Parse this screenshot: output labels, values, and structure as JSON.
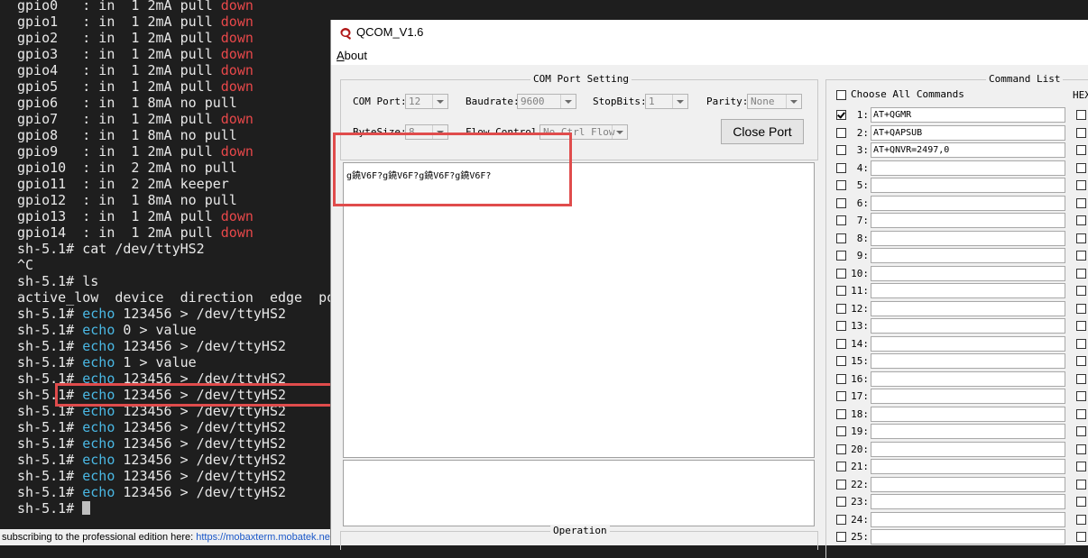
{
  "terminal": {
    "lines": [
      [
        {
          "t": "gpio0   : in  1 2mA pull "
        },
        {
          "t": "down",
          "c": "red"
        }
      ],
      [
        {
          "t": "gpio1   : in  1 2mA pull "
        },
        {
          "t": "down",
          "c": "red"
        }
      ],
      [
        {
          "t": "gpio2   : in  1 2mA pull "
        },
        {
          "t": "down",
          "c": "red"
        }
      ],
      [
        {
          "t": "gpio3   : in  1 2mA pull "
        },
        {
          "t": "down",
          "c": "red"
        }
      ],
      [
        {
          "t": "gpio4   : in  1 2mA pull "
        },
        {
          "t": "down",
          "c": "red"
        }
      ],
      [
        {
          "t": "gpio5   : in  1 2mA pull "
        },
        {
          "t": "down",
          "c": "red"
        }
      ],
      [
        {
          "t": "gpio6   : in  1 8mA no pull"
        }
      ],
      [
        {
          "t": "gpio7   : in  1 2mA pull "
        },
        {
          "t": "down",
          "c": "red"
        }
      ],
      [
        {
          "t": "gpio8   : in  1 8mA no pull"
        }
      ],
      [
        {
          "t": "gpio9   : in  1 2mA pull "
        },
        {
          "t": "down",
          "c": "red"
        }
      ],
      [
        {
          "t": "gpio10  : in  2 2mA no pull"
        }
      ],
      [
        {
          "t": "gpio11  : in  2 2mA keeper"
        }
      ],
      [
        {
          "t": "gpio12  : in  1 8mA no pull"
        }
      ],
      [
        {
          "t": "gpio13  : in  1 2mA pull "
        },
        {
          "t": "down",
          "c": "red"
        }
      ],
      [
        {
          "t": "gpio14  : in  1 2mA pull "
        },
        {
          "t": "down",
          "c": "red"
        }
      ],
      [
        {
          "t": "sh-5.1# cat /dev/ttyHS2"
        }
      ],
      [
        {
          "t": "^C"
        }
      ],
      [
        {
          "t": "sh-5.1# ls"
        }
      ],
      [
        {
          "t": "active_low  device  direction  edge  po"
        }
      ],
      [
        {
          "t": "sh-5.1# "
        },
        {
          "t": "echo",
          "c": "cyan"
        },
        {
          "t": " 123456 > /dev/ttyHS2"
        }
      ],
      [
        {
          "t": "sh-5.1# "
        },
        {
          "t": "echo",
          "c": "cyan"
        },
        {
          "t": " 0 > value"
        }
      ],
      [
        {
          "t": "sh-5.1# "
        },
        {
          "t": "echo",
          "c": "cyan"
        },
        {
          "t": " 123456 > /dev/ttyHS2"
        }
      ],
      [
        {
          "t": "sh-5.1# "
        },
        {
          "t": "echo",
          "c": "cyan"
        },
        {
          "t": " 1 > value"
        }
      ],
      [
        {
          "t": "sh-5.1# "
        },
        {
          "t": "echo",
          "c": "cyan"
        },
        {
          "t": " 123456 > /dev/ttyHS2"
        }
      ],
      [
        {
          "t": "sh-5.1# "
        },
        {
          "t": "echo",
          "c": "cyan"
        },
        {
          "t": " 123456 > /dev/ttyHS2"
        }
      ],
      [
        {
          "t": "sh-5.1# "
        },
        {
          "t": "echo",
          "c": "cyan"
        },
        {
          "t": " 123456 > /dev/ttyHS2"
        }
      ],
      [
        {
          "t": "sh-5.1# "
        },
        {
          "t": "echo",
          "c": "cyan"
        },
        {
          "t": " 123456 > /dev/ttyHS2"
        }
      ],
      [
        {
          "t": "sh-5.1# "
        },
        {
          "t": "echo",
          "c": "cyan"
        },
        {
          "t": " 123456 > /dev/ttyHS2"
        }
      ],
      [
        {
          "t": "sh-5.1# "
        },
        {
          "t": "echo",
          "c": "cyan"
        },
        {
          "t": " 123456 > /dev/ttyHS2"
        }
      ],
      [
        {
          "t": "sh-5.1# "
        },
        {
          "t": "echo",
          "c": "cyan"
        },
        {
          "t": " 123456 > /dev/ttyHS2"
        }
      ],
      [
        {
          "t": "sh-5.1# "
        },
        {
          "t": "echo",
          "c": "cyan"
        },
        {
          "t": " 123456 > /dev/ttyHS2"
        }
      ],
      [
        {
          "t": "sh-5.1# "
        },
        {
          "cursor": true
        }
      ]
    ]
  },
  "statusbar": {
    "text": "subscribing to the professional edition here: ",
    "link": "https://mobaxterm.mobatek.ne"
  },
  "qcom": {
    "title": "QCOM_V1.6",
    "menu_about": "About",
    "com_group_title": "COM Port Setting",
    "com_port_label": "COM Port:",
    "com_port_value": "12",
    "baudrate_label": "Baudrate:",
    "baudrate_value": "9600",
    "stopbits_label": "StopBits:",
    "stopbits_value": "1",
    "parity_label": "Parity:",
    "parity_value": "None",
    "bytesize_label": "ByteSize:",
    "bytesize_value": "8",
    "flow_label": "Flow Control:",
    "flow_value": "No Ctrl Flow",
    "close_port_label": "Close Port",
    "received_text": "g鐃V6F?g鐃V6F?g鐃V6F?g鐃V6F?",
    "operation_title": "Operation",
    "command_list_title": "Command List",
    "choose_all_label": "Choose All Commands",
    "hex_label": "HEX",
    "commands": [
      {
        "num": "1:",
        "text": "AT+QGMR",
        "checked": true
      },
      {
        "num": "2:",
        "text": "AT+QAPSUB",
        "checked": false
      },
      {
        "num": "3:",
        "text": "AT+QNVR=2497,0",
        "checked": false
      },
      {
        "num": "4:",
        "text": "",
        "checked": false
      },
      {
        "num": "5:",
        "text": "",
        "checked": false
      },
      {
        "num": "6:",
        "text": "",
        "checked": false
      },
      {
        "num": "7:",
        "text": "",
        "checked": false
      },
      {
        "num": "8:",
        "text": "",
        "checked": false
      },
      {
        "num": "9:",
        "text": "",
        "checked": false
      },
      {
        "num": "10:",
        "text": "",
        "checked": false
      },
      {
        "num": "11:",
        "text": "",
        "checked": false
      },
      {
        "num": "12:",
        "text": "",
        "checked": false
      },
      {
        "num": "13:",
        "text": "",
        "checked": false
      },
      {
        "num": "14:",
        "text": "",
        "checked": false
      },
      {
        "num": "15:",
        "text": "",
        "checked": false
      },
      {
        "num": "16:",
        "text": "",
        "checked": false
      },
      {
        "num": "17:",
        "text": "",
        "checked": false
      },
      {
        "num": "18:",
        "text": "",
        "checked": false
      },
      {
        "num": "19:",
        "text": "",
        "checked": false
      },
      {
        "num": "20:",
        "text": "",
        "checked": false
      },
      {
        "num": "21:",
        "text": "",
        "checked": false
      },
      {
        "num": "22:",
        "text": "",
        "checked": false
      },
      {
        "num": "23:",
        "text": "",
        "checked": false
      },
      {
        "num": "24:",
        "text": "",
        "checked": false
      },
      {
        "num": "25:",
        "text": "",
        "checked": false
      }
    ]
  }
}
